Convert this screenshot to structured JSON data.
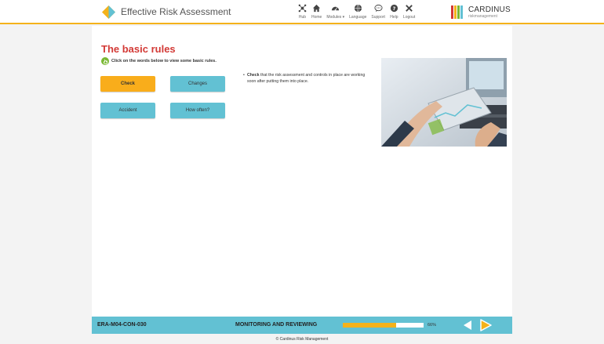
{
  "header": {
    "app_title": "Effective Risk Assessment",
    "nav": [
      {
        "label": "Hub",
        "icon": "hub-icon"
      },
      {
        "label": "Home",
        "icon": "home-icon"
      },
      {
        "label": "Modules ▾",
        "icon": "modules-icon"
      },
      {
        "label": "Language",
        "icon": "globe-icon"
      },
      {
        "label": "Support",
        "icon": "chat-icon"
      },
      {
        "label": "Help",
        "icon": "help-icon"
      },
      {
        "label": "Logout",
        "icon": "close-icon"
      }
    ],
    "brand": {
      "name": "CARDINUS",
      "subtitle": "riskmanagement"
    }
  },
  "main": {
    "title": "The basic rules",
    "instruction": "Click on the words below to view some basic rules.",
    "buttons": {
      "check": "Check",
      "changes": "Changes",
      "accident": "Accident",
      "how_often": "How often?"
    },
    "bullet": {
      "bold": "Check",
      "text": " that the risk assessment and controls in place are working soon after putting them into place."
    }
  },
  "footer": {
    "module_code": "ERA-M04-CON-030",
    "section_name": "MONITORING AND REVIEWING",
    "progress_percent": 66,
    "progress_label": "66%",
    "copyright": "© Cardinus Risk Management"
  },
  "colors": {
    "accent": "#f4b21a",
    "teal": "#62c1d3",
    "title_red": "#d33a36",
    "button_active": "#f9ad1b",
    "hint_green": "#7ab833"
  }
}
